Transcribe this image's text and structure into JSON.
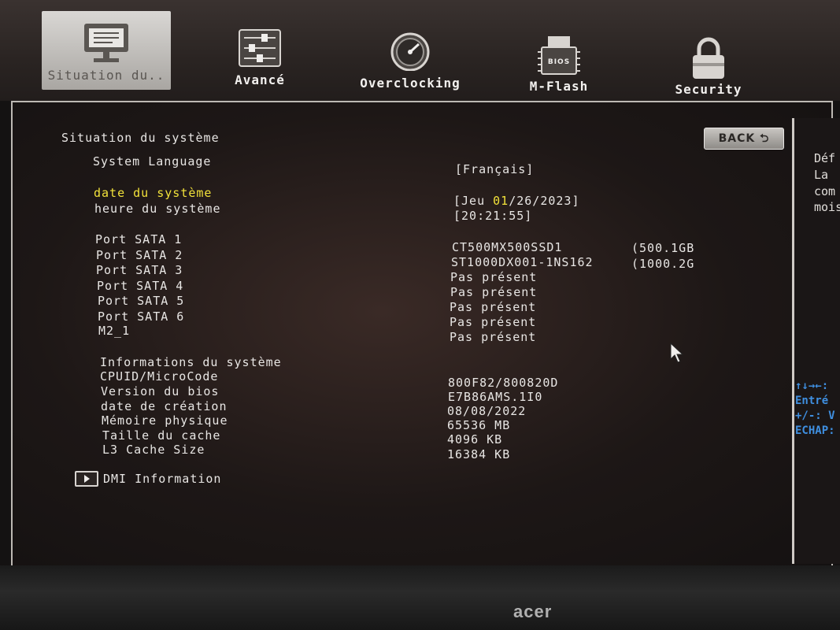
{
  "tabs": [
    {
      "label": "Situation du..",
      "icon": "monitor-icon",
      "active": true
    },
    {
      "label": "Avancé",
      "icon": "sliders-icon"
    },
    {
      "label": "Overclocking",
      "icon": "speedometer-icon"
    },
    {
      "label": "M-Flash",
      "icon": "bios-chip-icon",
      "chip_text": "BIOS"
    },
    {
      "label": "Security",
      "icon": "padlock-icon"
    }
  ],
  "page": {
    "title": "Situation du système",
    "back_label": "BACK"
  },
  "settings": {
    "language_label": "System Language",
    "language_value": "[Français]",
    "date_label": "date du système",
    "date_value_prefix": "[Jeu ",
    "date_value_month": "01",
    "date_value_rest": "/26/2023]",
    "time_label": "heure du système",
    "time_value": "[20:21:55]"
  },
  "ports": [
    {
      "label": "Port SATA 1",
      "value": "CT500MX500SSD1",
      "size": "(500.1GB"
    },
    {
      "label": "Port SATA 2",
      "value": "ST1000DX001-1NS162",
      "size": "(1000.2G"
    },
    {
      "label": "Port SATA 3",
      "value": "Pas présent",
      "size": ""
    },
    {
      "label": "Port SATA 4",
      "value": "Pas présent",
      "size": ""
    },
    {
      "label": "Port SATA 5",
      "value": "Pas présent",
      "size": ""
    },
    {
      "label": "Port SATA 6",
      "value": "Pas présent",
      "size": ""
    },
    {
      "label": "M2_1",
      "value": "Pas présent",
      "size": ""
    }
  ],
  "sysinfo": {
    "heading": "Informations du système",
    "rows": [
      {
        "label": "CPUID/MicroCode",
        "value": "800F82/800820D"
      },
      {
        "label": "Version du bios",
        "value": "E7B86AMS.1I0"
      },
      {
        "label": "date de création",
        "value": "08/08/2022"
      },
      {
        "label": "Mémoire physique",
        "value": "65536 MB"
      },
      {
        "label": "Taille du cache",
        "value": "4096 KB"
      },
      {
        "label": "L3 Cache Size",
        "value": "16384 KB"
      }
    ]
  },
  "dmi_label": "DMI Information",
  "help_panel": {
    "lines": [
      "Déf",
      "La",
      "com",
      "mois"
    ],
    "keys": [
      "↑↓→←:",
      "Entré",
      "+/-: V",
      "ECHAP:"
    ]
  },
  "monitor_brand": "acer",
  "colors": {
    "highlight": "#f2e23a",
    "keys": "#3f8fe0"
  }
}
